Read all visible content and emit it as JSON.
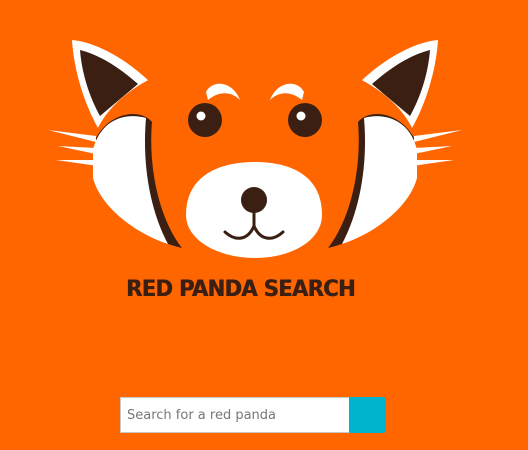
{
  "brand": {
    "title": "RED PANDA SEARCH",
    "logo_icon": "red-panda-face-icon"
  },
  "search": {
    "placeholder": "Search for a red panda",
    "value": "",
    "button_label": "",
    "button_color": "#00B4CE"
  },
  "colors": {
    "background": "#FF6600",
    "accent_dark": "#3A1F12",
    "face_white": "#FFFFFF"
  }
}
